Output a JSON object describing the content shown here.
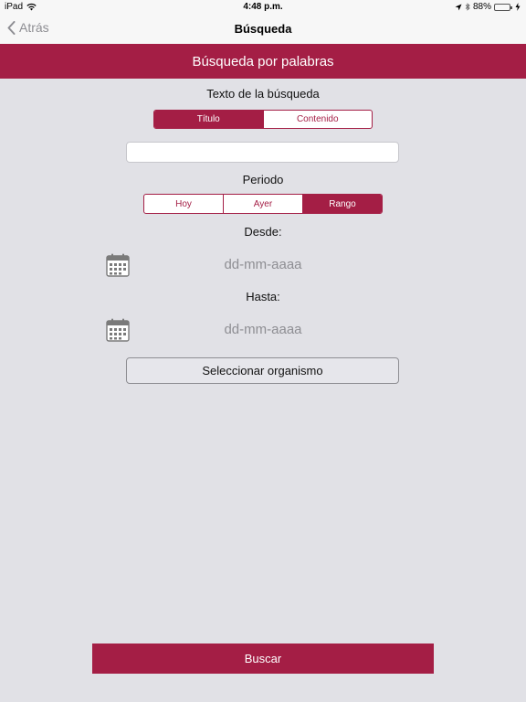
{
  "status_bar": {
    "device": "iPad",
    "time": "4:48 p.m.",
    "battery": "88%",
    "battery_level": 0.88
  },
  "nav": {
    "back_label": "Atrás",
    "title": "Búsqueda"
  },
  "header": {
    "title": "Búsqueda por palabras"
  },
  "search": {
    "label": "Texto de la búsqueda",
    "scope_options": [
      "Título",
      "Contenido"
    ],
    "scope_selected": "Título",
    "input_value": ""
  },
  "period": {
    "label": "Periodo",
    "options": [
      "Hoy",
      "Ayer",
      "Rango"
    ],
    "selected": "Rango"
  },
  "from": {
    "label": "Desde:",
    "placeholder": "dd-mm-aaaa"
  },
  "to": {
    "label": "Hasta:",
    "placeholder": "dd-mm-aaaa"
  },
  "organism_button_label": "Seleccionar organismo",
  "search_button_label": "Buscar",
  "colors": {
    "accent": "#a41e45",
    "background": "#e1e1e6",
    "placeholder_text": "#8e8e93"
  },
  "icons": [
    "wifi-icon",
    "location-arrow-icon",
    "bluetooth-icon",
    "battery-icon",
    "charging-bolt-icon",
    "chevron-left-icon",
    "calendar-icon"
  ]
}
